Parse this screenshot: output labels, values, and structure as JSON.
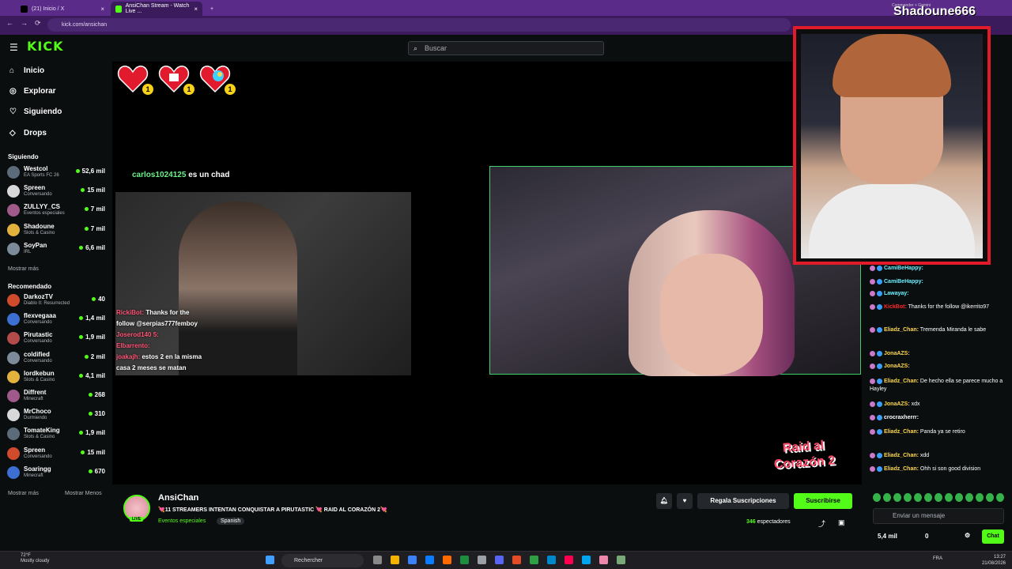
{
  "browser": {
    "tabs": [
      {
        "label": "(21) Inicio / X",
        "close": "×"
      },
      {
        "label": "AnsiChan Stream - Watch Live ...",
        "close": "×"
      }
    ],
    "new_tab": "+",
    "url": "kick.com/ansichan",
    "back": "←",
    "forward": "→",
    "reload": "⟳"
  },
  "header": {
    "logo": "KICK",
    "search_placeholder": "Buscar"
  },
  "sidebar": {
    "nav": [
      {
        "label": "Inicio",
        "icon": "home-icon"
      },
      {
        "label": "Explorar",
        "icon": "compass-icon"
      },
      {
        "label": "Siguiendo",
        "icon": "heart-icon"
      },
      {
        "label": "Drops",
        "icon": "drops-icon"
      }
    ],
    "following_title": "Siguiendo",
    "following": [
      {
        "name": "Westcol",
        "category": "EA Sports FC 26",
        "viewers": "52,6 mil"
      },
      {
        "name": "Spreen",
        "category": "Conversando",
        "viewers": "15 mil"
      },
      {
        "name": "ZULLYY_CS",
        "category": "Eventos especiales",
        "viewers": "7 mil"
      },
      {
        "name": "Shadoune",
        "category": "Slots & Casino",
        "viewers": "7 mil"
      },
      {
        "name": "SoyPan",
        "category": "IRL",
        "viewers": "6,6 mil"
      }
    ],
    "show_more_1": "Mostrar más",
    "recommended_title": "Recomendado",
    "recommended": [
      {
        "name": "DarkozTV",
        "category": "Diablo II: Resurrected",
        "viewers": "40"
      },
      {
        "name": "flexvegaaa",
        "category": "Conversando",
        "viewers": "1,4 mil"
      },
      {
        "name": "Pirutastic",
        "category": "Conversando",
        "viewers": "1,9 mil"
      },
      {
        "name": "coldified",
        "category": "Conversando",
        "viewers": "2 mil"
      },
      {
        "name": "lordkebun",
        "category": "Slots & Casino",
        "viewers": "4,1 mil"
      },
      {
        "name": "Diffrent",
        "category": "Minecraft",
        "viewers": "268"
      },
      {
        "name": "MrChoco",
        "category": "Durmiendo",
        "viewers": "310"
      },
      {
        "name": "TomateKing",
        "category": "Slots & Casino",
        "viewers": "1,9 mil"
      },
      {
        "name": "Spreen",
        "category": "Conversando",
        "viewers": "15 mil"
      },
      {
        "name": "Soaringg",
        "category": "Minecraft",
        "viewers": "670"
      }
    ],
    "show_more_2": "Mostrar más",
    "show_less": "Mostrar Menos"
  },
  "stream": {
    "hearts": [
      "1",
      "1",
      "1"
    ],
    "caption_user": "carlos1024125",
    "caption_text": "es un chad",
    "overlay_chat": [
      {
        "user": "RickiBot:",
        "text": "Thanks for the"
      },
      {
        "user": "",
        "text": "follow @serpias777femboy"
      },
      {
        "user": "Joserod140 5:",
        "text": ""
      },
      {
        "user": "Elbarrento:",
        "text": ""
      },
      {
        "user": "joakajh:",
        "text": "estos 2 en la misma"
      },
      {
        "user": "",
        "text": "casa 2 meses se matan"
      }
    ],
    "raid_logo": "Raid al Corazón 2",
    "overlay_name": "Shadoune666",
    "overlay_small": "Commander + Gemini"
  },
  "chat": {
    "messages": [
      {
        "user": "CamiBeHappy:",
        "text": "",
        "color": "#6cf0ff"
      },
      {
        "user": "CamiBeHappy:",
        "text": "",
        "color": "#6cf0ff"
      },
      {
        "user": "Lawayay:",
        "text": "",
        "color": "#6cf0ff"
      },
      {
        "user": "KickBot:",
        "text": "Thanks for the follow @ikerrito97",
        "color": "#ff2a2a"
      },
      {
        "user": "Eliadz_Chan:",
        "text": "Tremenda Miranda le sabe",
        "color": "#ffd84a"
      },
      {
        "user": "JonaAZS:",
        "text": "",
        "color": "#ffd84a"
      },
      {
        "user": "JonaAZS:",
        "text": "",
        "color": "#ffd84a"
      },
      {
        "user": "Eliadz_Chan:",
        "text": "De hecho ella se parece mucho a Hayley",
        "color": "#ffd84a"
      },
      {
        "user": "JonaAZS:",
        "text": "xdx",
        "color": "#ffd84a"
      },
      {
        "user": "crocraxherrr:",
        "text": "",
        "color": "#ffffff"
      },
      {
        "user": "Eliadz_Chan:",
        "text": "Panda ya se retiro",
        "color": "#ffd84a"
      },
      {
        "user": "Eliadz_Chan:",
        "text": "xdd",
        "color": "#ffd84a"
      },
      {
        "user": "Eliadz_Chan:",
        "text": "Ohh si son good division",
        "color": "#ffd84a"
      }
    ],
    "input_placeholder": "Enviar un mensaje",
    "stat_a": "5,4 mil",
    "stat_b": "0",
    "send_label": "Chat"
  },
  "info": {
    "streamer": "AnsiChan",
    "live": "LIVE",
    "title": "💘11 STREAMERS INTENTAN CONQUISTAR A PIRUTASTIC 💘 RAID AL CORAZÓN 2💘",
    "category": "Eventos especiales",
    "language": "Spanish",
    "gift_label": "Regala Suscripciones",
    "subscribe_label": "Suscribirse",
    "viewers_count": "346",
    "viewers_label": "espectadores"
  },
  "taskbar": {
    "temp": "72°F",
    "weather": "Mostly cloudy",
    "search": "Rechercher",
    "lang": "FRA",
    "time": "13:27",
    "date": "21/08/2026"
  },
  "colors": {
    "accent": "#53fc18",
    "browser": "#5b2b8a",
    "webcam_border": "#e21b2a"
  }
}
